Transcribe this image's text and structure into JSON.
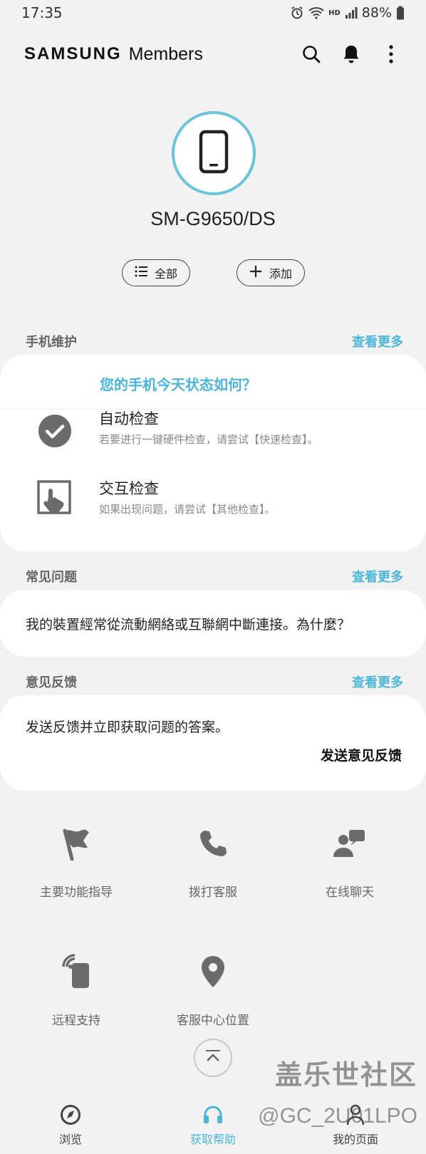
{
  "status_bar": {
    "time": "17:35",
    "battery_percent": "88%",
    "network_badge": "HD"
  },
  "app_bar": {
    "brand": "SAMSUNG",
    "brand_sub": "Members",
    "icons": [
      "search-icon",
      "bell-icon",
      "more-vert-icon"
    ]
  },
  "device": {
    "model": "SM-G9650/DS",
    "all_button": "全部",
    "add_button": "添加",
    "accent": "#6cc3dc"
  },
  "maintenance": {
    "title": "手机维护",
    "more": "查看更多",
    "question": "您的手机今天状态如何？",
    "items": [
      {
        "title": "自动检查",
        "desc": "若要进行一键硬件检查，请尝试【快速检查】。",
        "icon": "check-circle-icon"
      },
      {
        "title": "交互检查",
        "desc": "如果出现问题，请尝试【其他检查】。",
        "icon": "touch-screen-icon"
      }
    ]
  },
  "faq": {
    "title": "常见问题",
    "more": "查看更多",
    "question": "我的裝置經常從流動網絡或互聯網中斷連接。為什麼？"
  },
  "feedback": {
    "title": "意见反馈",
    "more": "查看更多",
    "text": "发送反馈并立即获取问题的答案。",
    "button": "发送意见反馈"
  },
  "services": [
    {
      "label": "主要功能指导",
      "icon": "flag-icon"
    },
    {
      "label": "拨打客服",
      "icon": "phone-icon"
    },
    {
      "label": "在线聊天",
      "icon": "chat-icon"
    },
    {
      "label": "远程支持",
      "icon": "remote-support-icon"
    },
    {
      "label": "客服中心位置",
      "icon": "location-pin-icon"
    }
  ],
  "bottom_nav": {
    "items": [
      {
        "label": "浏览",
        "icon": "compass-icon",
        "active": false
      },
      {
        "label": "获取帮助",
        "icon": "headset-icon",
        "active": true
      },
      {
        "label": "我的页面",
        "icon": "person-icon",
        "active": false
      }
    ]
  },
  "watermark": {
    "line1": "盖乐世社区",
    "line2": "@GC_2U01LPO"
  },
  "colors": {
    "accent": "#4ab6da",
    "background": "#f2f2f2",
    "card": "#ffffff"
  }
}
